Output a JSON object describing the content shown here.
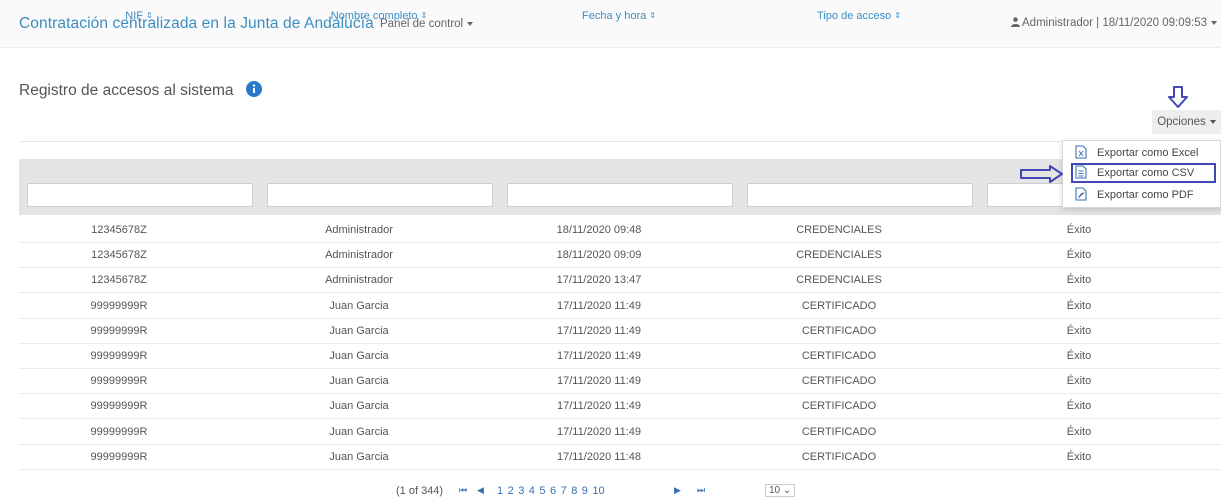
{
  "navbar": {
    "brand": "Contratación centralizada en la Junta de Andalucía",
    "panel_menu": "Panel de control",
    "user_info": "Administrador | 18/11/2020 09:09:53"
  },
  "page": {
    "title": "Registro de accesos al sistema"
  },
  "options": {
    "button_label": "Opciones",
    "menu": [
      {
        "label": "Exportar como Excel",
        "icon": "excel-file-icon"
      },
      {
        "label": "Exportar como CSV",
        "icon": "csv-file-icon",
        "highlighted": true
      },
      {
        "label": "Exportar como PDF",
        "icon": "pdf-file-icon"
      }
    ]
  },
  "table": {
    "columns": [
      {
        "label": "NIF",
        "sort": "⇕"
      },
      {
        "label": "Nombre completo",
        "sort": "⇕"
      },
      {
        "label": "Fecha y hora",
        "sort": "⇕"
      },
      {
        "label": "Tipo de acceso",
        "sort": "⇕"
      },
      {
        "label": "",
        "sort": ""
      }
    ],
    "rows": [
      [
        "12345678Z",
        "Administrador",
        "18/11/2020 09:48",
        "CREDENCIALES",
        "Éxito"
      ],
      [
        "12345678Z",
        "Administrador",
        "18/11/2020 09:09",
        "CREDENCIALES",
        "Éxito"
      ],
      [
        "12345678Z",
        "Administrador",
        "17/11/2020 13:47",
        "CREDENCIALES",
        "Éxito"
      ],
      [
        "99999999R",
        "Juan Garcia",
        "17/11/2020 11:49",
        "CERTIFICADO",
        "Éxito"
      ],
      [
        "99999999R",
        "Juan Garcia",
        "17/11/2020 11:49",
        "CERTIFICADO",
        "Éxito"
      ],
      [
        "99999999R",
        "Juan Garcia",
        "17/11/2020 11:49",
        "CERTIFICADO",
        "Éxito"
      ],
      [
        "99999999R",
        "Juan Garcia",
        "17/11/2020 11:49",
        "CERTIFICADO",
        "Éxito"
      ],
      [
        "99999999R",
        "Juan Garcia",
        "17/11/2020 11:49",
        "CERTIFICADO",
        "Éxito"
      ],
      [
        "99999999R",
        "Juan Garcia",
        "17/11/2020 11:49",
        "CERTIFICADO",
        "Éxito"
      ],
      [
        "99999999R",
        "Juan Garcia",
        "17/11/2020 11:48",
        "CERTIFICADO",
        "Éxito"
      ]
    ]
  },
  "pagination": {
    "summary": "(1 of 344)",
    "first": "⏮",
    "prev": "◀",
    "pages": [
      "1",
      "2",
      "3",
      "4",
      "5",
      "6",
      "7",
      "8",
      "9",
      "10"
    ],
    "next": "▶",
    "last": "⏭",
    "page_size": "10 ⌄"
  },
  "colors": {
    "accent": "#3b8ec2",
    "highlight_annotation": "#4148b4",
    "header_bg": "#e4e4e4"
  }
}
